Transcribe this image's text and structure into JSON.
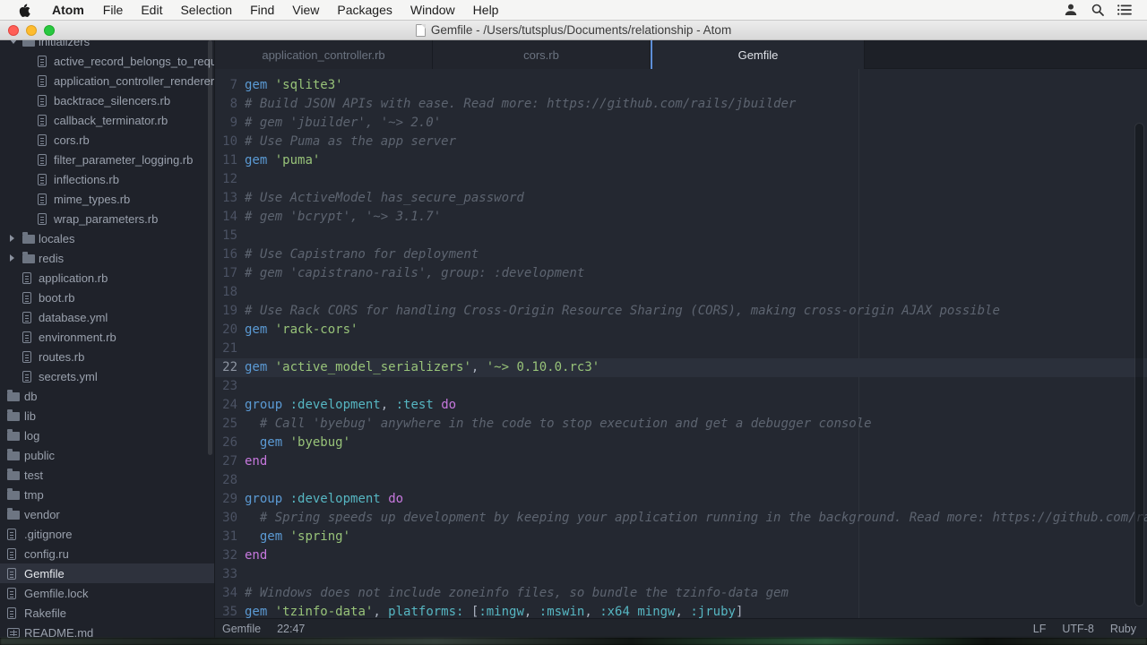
{
  "menu_bar": {
    "items": [
      "Atom",
      "File",
      "Edit",
      "Selection",
      "Find",
      "View",
      "Packages",
      "Window",
      "Help"
    ],
    "right_icons": [
      "user-icon",
      "search-icon",
      "list-icon"
    ]
  },
  "title_bar": {
    "title": "Gemfile - /Users/tutsplus/Documents/relationship - Atom"
  },
  "sidebar": {
    "items": [
      {
        "label": "initializers",
        "icon": "folder",
        "chevron": "open",
        "indent": 1
      },
      {
        "label": "active_record_belongs_to_required",
        "icon": "file",
        "indent": 2
      },
      {
        "label": "application_controller_renderer.rb",
        "icon": "file",
        "indent": 2
      },
      {
        "label": "backtrace_silencers.rb",
        "icon": "file",
        "indent": 2
      },
      {
        "label": "callback_terminator.rb",
        "icon": "file",
        "indent": 2
      },
      {
        "label": "cors.rb",
        "icon": "file",
        "indent": 2
      },
      {
        "label": "filter_parameter_logging.rb",
        "icon": "file",
        "indent": 2
      },
      {
        "label": "inflections.rb",
        "icon": "file",
        "indent": 2
      },
      {
        "label": "mime_types.rb",
        "icon": "file",
        "indent": 2
      },
      {
        "label": "wrap_parameters.rb",
        "icon": "file",
        "indent": 2
      },
      {
        "label": "locales",
        "icon": "folder",
        "chevron": "closed",
        "indent": 1
      },
      {
        "label": "redis",
        "icon": "folder",
        "chevron": "closed",
        "indent": 1
      },
      {
        "label": "application.rb",
        "icon": "file",
        "indent": 1
      },
      {
        "label": "boot.rb",
        "icon": "file",
        "indent": 1
      },
      {
        "label": "database.yml",
        "icon": "file",
        "indent": 1
      },
      {
        "label": "environment.rb",
        "icon": "file",
        "indent": 1
      },
      {
        "label": "routes.rb",
        "icon": "file",
        "indent": 1
      },
      {
        "label": "secrets.yml",
        "icon": "file",
        "indent": 1
      },
      {
        "label": "db",
        "icon": "folder",
        "indent": 0
      },
      {
        "label": "lib",
        "icon": "folder",
        "indent": 0
      },
      {
        "label": "log",
        "icon": "folder",
        "indent": 0
      },
      {
        "label": "public",
        "icon": "folder",
        "indent": 0
      },
      {
        "label": "test",
        "icon": "folder",
        "indent": 0
      },
      {
        "label": "tmp",
        "icon": "folder",
        "indent": 0
      },
      {
        "label": "vendor",
        "icon": "folder",
        "indent": 0
      },
      {
        "label": ".gitignore",
        "icon": "file",
        "indent": 0
      },
      {
        "label": "config.ru",
        "icon": "file",
        "indent": 0
      },
      {
        "label": "Gemfile",
        "icon": "file",
        "indent": 0,
        "selected": true
      },
      {
        "label": "Gemfile.lock",
        "icon": "file",
        "indent": 0
      },
      {
        "label": "Rakefile",
        "icon": "file",
        "indent": 0
      },
      {
        "label": "README.md",
        "icon": "book",
        "indent": 0
      }
    ]
  },
  "tabs": [
    {
      "label": "application_controller.rb",
      "active": false
    },
    {
      "label": "cors.rb",
      "active": false
    },
    {
      "label": "Gemfile",
      "active": true
    }
  ],
  "editor": {
    "cursor_line": 22,
    "lines": [
      {
        "n": 7,
        "seg": [
          [
            "k",
            "gem"
          ],
          [
            "d",
            " "
          ],
          [
            "s",
            "'sqlite3'"
          ]
        ]
      },
      {
        "n": 8,
        "seg": [
          [
            "c",
            "# Build JSON APIs with ease. Read more: https://github.com/rails/jbuilder"
          ]
        ]
      },
      {
        "n": 9,
        "seg": [
          [
            "c",
            "# gem 'jbuilder', '~> 2.0'"
          ]
        ]
      },
      {
        "n": 10,
        "seg": [
          [
            "c",
            "# Use Puma as the app server"
          ]
        ]
      },
      {
        "n": 11,
        "seg": [
          [
            "k",
            "gem"
          ],
          [
            "d",
            " "
          ],
          [
            "s",
            "'puma'"
          ]
        ]
      },
      {
        "n": 12,
        "seg": []
      },
      {
        "n": 13,
        "seg": [
          [
            "c",
            "# Use ActiveModel has_secure_password"
          ]
        ]
      },
      {
        "n": 14,
        "seg": [
          [
            "c",
            "# gem 'bcrypt', '~> 3.1.7'"
          ]
        ]
      },
      {
        "n": 15,
        "seg": []
      },
      {
        "n": 16,
        "seg": [
          [
            "c",
            "# Use Capistrano for deployment"
          ]
        ]
      },
      {
        "n": 17,
        "seg": [
          [
            "c",
            "# gem 'capistrano-rails', group: :development"
          ]
        ]
      },
      {
        "n": 18,
        "seg": []
      },
      {
        "n": 19,
        "seg": [
          [
            "c",
            "# Use Rack CORS for handling Cross-Origin Resource Sharing (CORS), making cross-origin AJAX possible"
          ]
        ]
      },
      {
        "n": 20,
        "seg": [
          [
            "k",
            "gem"
          ],
          [
            "d",
            " "
          ],
          [
            "s",
            "'rack-cors'"
          ]
        ]
      },
      {
        "n": 21,
        "seg": []
      },
      {
        "n": 22,
        "seg": [
          [
            "k",
            "gem"
          ],
          [
            "d",
            " "
          ],
          [
            "s",
            "'active_model_serializers'"
          ],
          [
            "d",
            ", "
          ],
          [
            "s",
            "'~> 0.10.0.rc3'"
          ]
        ]
      },
      {
        "n": 23,
        "seg": []
      },
      {
        "n": 24,
        "seg": [
          [
            "k",
            "group"
          ],
          [
            "d",
            " "
          ],
          [
            "y",
            ":development"
          ],
          [
            "d",
            ", "
          ],
          [
            "y",
            ":test"
          ],
          [
            "d",
            " "
          ],
          [
            "p",
            "do"
          ]
        ]
      },
      {
        "n": 25,
        "seg": [
          [
            "c",
            "  # Call 'byebug' anywhere in the code to stop execution and get a debugger console"
          ]
        ]
      },
      {
        "n": 26,
        "seg": [
          [
            "d",
            "  "
          ],
          [
            "k",
            "gem"
          ],
          [
            "d",
            " "
          ],
          [
            "s",
            "'byebug'"
          ]
        ]
      },
      {
        "n": 27,
        "seg": [
          [
            "p",
            "end"
          ]
        ]
      },
      {
        "n": 28,
        "seg": []
      },
      {
        "n": 29,
        "seg": [
          [
            "k",
            "group"
          ],
          [
            "d",
            " "
          ],
          [
            "y",
            ":development"
          ],
          [
            "d",
            " "
          ],
          [
            "p",
            "do"
          ]
        ]
      },
      {
        "n": 30,
        "seg": [
          [
            "c",
            "  # Spring speeds up development by keeping your application running in the background. Read more: https://github.com/rails/spring"
          ]
        ]
      },
      {
        "n": 31,
        "seg": [
          [
            "d",
            "  "
          ],
          [
            "k",
            "gem"
          ],
          [
            "d",
            " "
          ],
          [
            "s",
            "'spring'"
          ]
        ]
      },
      {
        "n": 32,
        "seg": [
          [
            "p",
            "end"
          ]
        ]
      },
      {
        "n": 33,
        "seg": []
      },
      {
        "n": 34,
        "seg": [
          [
            "c",
            "# Windows does not include zoneinfo files, so bundle the tzinfo-data gem"
          ]
        ]
      },
      {
        "n": 35,
        "seg": [
          [
            "k",
            "gem"
          ],
          [
            "d",
            " "
          ],
          [
            "s",
            "'tzinfo-data'"
          ],
          [
            "d",
            ", "
          ],
          [
            "y",
            "platforms:"
          ],
          [
            "d",
            " ["
          ],
          [
            "y",
            ":mingw"
          ],
          [
            "d",
            ", "
          ],
          [
            "y",
            ":mswin"
          ],
          [
            "d",
            ", "
          ],
          [
            "y",
            ":x64_mingw"
          ],
          [
            "d",
            ", "
          ],
          [
            "y",
            ":jruby"
          ],
          [
            "d",
            "]"
          ]
        ]
      }
    ]
  },
  "status_bar": {
    "file": "Gemfile",
    "position": "22:47",
    "right": [
      "LF",
      "UTF-8",
      "Ruby"
    ]
  },
  "colors": {
    "accent_blue": "#5e8fd8",
    "keyword": "#5b9ad4",
    "string": "#98c379",
    "symbol": "#56b6c2",
    "control": "#c678dd",
    "comment": "#5d6470",
    "editor_bg": "#242831",
    "tree_bg": "#1f222a",
    "traffic_close": "#ff5f57",
    "traffic_min": "#febc2e",
    "traffic_max": "#28c840"
  }
}
